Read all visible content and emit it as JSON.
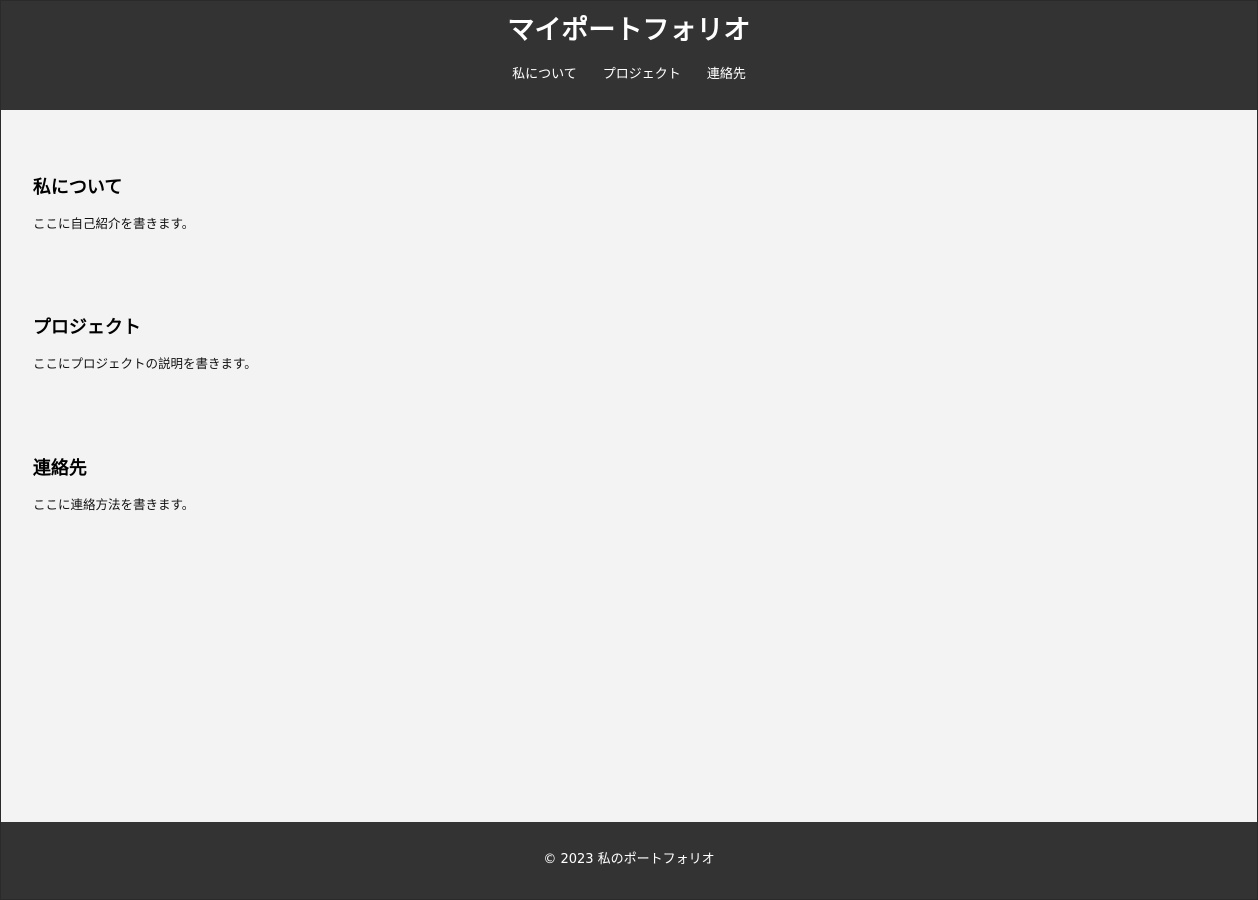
{
  "header": {
    "title": "マイポートフォリオ",
    "nav": [
      {
        "label": "私について"
      },
      {
        "label": "プロジェクト"
      },
      {
        "label": "連絡先"
      }
    ]
  },
  "sections": {
    "about": {
      "heading": "私について",
      "text": "ここに自己紹介を書きます。"
    },
    "projects": {
      "heading": "プロジェクト",
      "text": "ここにプロジェクトの説明を書きます。"
    },
    "contact": {
      "heading": "連絡先",
      "text": "ここに連絡方法を書きます。"
    }
  },
  "footer": {
    "text": "© 2023 私のポートフォリオ"
  },
  "colors": {
    "header_bg": "#333333",
    "page_bg": "#f3f3f3",
    "header_text": "#ffffff"
  }
}
